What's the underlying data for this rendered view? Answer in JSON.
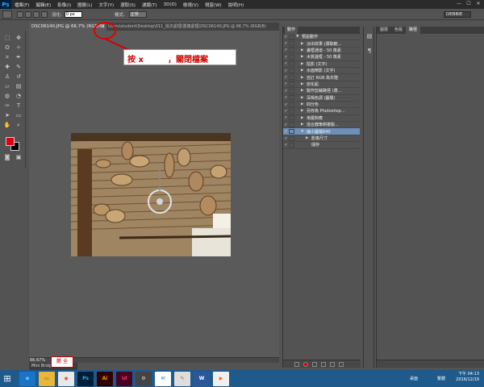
{
  "menubar": {
    "logo": "Ps",
    "items": [
      "檔案(F)",
      "編輯(E)",
      "影像(I)",
      "圖層(L)",
      "文字(Y)",
      "選取(S)",
      "濾鏡(T)",
      "3D(D)",
      "檢視(V)",
      "視窗(W)",
      "說明(H)"
    ],
    "window_buttons": [
      "—",
      "☐",
      "✕"
    ]
  },
  "options": {
    "feather_label": "羽化:",
    "feather_value": "0 px",
    "style_label": "樣式:",
    "style_value": "正常",
    "workspace": "DEBBIE"
  },
  "document": {
    "tab_label": "DSC06140.JPG @ 66.7% (RGB/8)",
    "close_glyph": "x",
    "path_label": "Users\\student\\Desktop\\011_批次處理\\重複處理\\DSC06140.JPG @ 66.7% (RGB/8)",
    "zoom": "66.67%",
    "mini_bridge": "Mini Bridge"
  },
  "annotation": {
    "instruction_part1": "按 x",
    "instruction_part2": "，關閉檔案",
    "stamp": "艷 全"
  },
  "actions_panel": {
    "tab": "動作",
    "rows": [
      {
        "label": "預設動作",
        "checked": true,
        "expand": "▼",
        "indent": 0
      },
      {
        "label": "淡出效果 (選取範...",
        "checked": true,
        "expand": "▶",
        "indent": 1
      },
      {
        "label": "畫框通道 - 50 像素",
        "checked": true,
        "expand": "▶",
        "indent": 1
      },
      {
        "label": "木質邊框 - 50 像素",
        "checked": true,
        "expand": "▶",
        "indent": 1
      },
      {
        "label": "陰影 (文字)",
        "checked": true,
        "expand": "▶",
        "indent": 1
      },
      {
        "label": "水面倒影 (文字)",
        "checked": true,
        "expand": "▶",
        "indent": 1
      },
      {
        "label": "自訂 RGB 為灰階",
        "checked": true,
        "expand": "▶",
        "indent": 1
      },
      {
        "label": "熔化鉛",
        "checked": true,
        "expand": "▶",
        "indent": 1
      },
      {
        "label": "製作剪裁路徑 (選...",
        "checked": true,
        "expand": "▶",
        "indent": 1
      },
      {
        "label": "深褐色調 (圖層)",
        "checked": true,
        "expand": "▶",
        "indent": 1
      },
      {
        "label": "四分色",
        "checked": true,
        "expand": "▶",
        "indent": 1
      },
      {
        "label": "另存為 Photoshop...",
        "checked": true,
        "expand": "▶",
        "indent": 1
      },
      {
        "label": "漸層對應",
        "checked": true,
        "expand": "▶",
        "indent": 1
      },
      {
        "label": "混合器筆刷複製...",
        "checked": true,
        "expand": "▶",
        "indent": 1
      },
      {
        "label": "縮小圖檔640",
        "checked": true,
        "expand": "▼",
        "indent": 1,
        "selected": true
      },
      {
        "label": "影像尺寸",
        "checked": true,
        "expand": "▶",
        "indent": 2
      },
      {
        "label": "儲存",
        "checked": true,
        "expand": "",
        "indent": 2
      }
    ]
  },
  "right_panel": {
    "tabs": [
      "圖層",
      "色版",
      "路徑"
    ]
  },
  "taskbar": {
    "apps": [
      {
        "name": "ie",
        "label": "e",
        "bg": "#1a73c7",
        "fg": "#8fe3ff"
      },
      {
        "name": "explorer",
        "label": "▭",
        "bg": "#e8b63a",
        "fg": "#6b4a00"
      },
      {
        "name": "chrome",
        "label": "◉",
        "bg": "#e8e8e8",
        "fg": "#db4437"
      },
      {
        "name": "photoshop",
        "label": "Ps",
        "bg": "#001e36",
        "fg": "#31a8ff"
      },
      {
        "name": "illustrator",
        "label": "Ai",
        "bg": "#330000",
        "fg": "#ff9a00"
      },
      {
        "name": "indesign",
        "label": "Id",
        "bg": "#49021f",
        "fg": "#ff3366"
      },
      {
        "name": "settings",
        "label": "⚙",
        "bg": "#444",
        "fg": "#ddd"
      },
      {
        "name": "mail",
        "label": "✉",
        "bg": "#fff",
        "fg": "#1a73c7"
      },
      {
        "name": "paint",
        "label": "✎",
        "bg": "#ddd",
        "fg": "#c06000"
      },
      {
        "name": "word",
        "label": "W",
        "bg": "#2b579a",
        "fg": "#fff"
      },
      {
        "name": "media",
        "label": "▶",
        "bg": "#f0f0f0",
        "fg": "#ff6a00"
      }
    ],
    "desktop_label": "桌面",
    "ime": "繁體",
    "time": "下午 04:13",
    "date": "2016/12/19"
  }
}
